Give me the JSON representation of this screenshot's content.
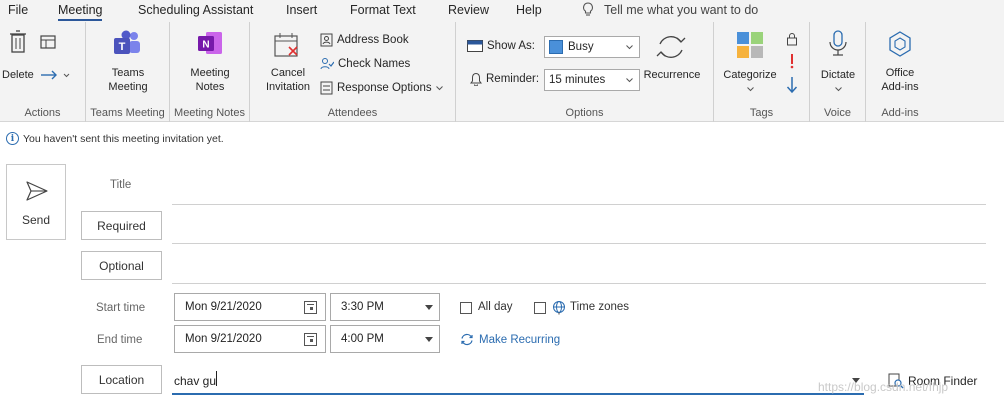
{
  "menu": {
    "tabs": [
      "File",
      "Meeting",
      "Scheduling Assistant",
      "Insert",
      "Format Text",
      "Review",
      "Help"
    ],
    "active": "Meeting",
    "tell_me": "Tell me what you want to do"
  },
  "ribbon": {
    "actions": {
      "delete_label": "Delete",
      "group_label": "Actions"
    },
    "teams": {
      "button_line1": "Teams",
      "button_line2": "Meeting",
      "group_label": "Teams Meeting"
    },
    "notes": {
      "button_line1": "Meeting",
      "button_line2": "Notes",
      "group_label": "Meeting Notes"
    },
    "attendees": {
      "cancel_line1": "Cancel",
      "cancel_line2": "Invitation",
      "address_book": "Address Book",
      "check_names": "Check Names",
      "response_options": "Response Options",
      "group_label": "Attendees"
    },
    "options": {
      "show_as_label": "Show As:",
      "show_as_value": "Busy",
      "reminder_label": "Reminder:",
      "reminder_value": "15 minutes",
      "recurrence": "Recurrence",
      "group_label": "Options"
    },
    "tags": {
      "categorize": "Categorize",
      "group_label": "Tags"
    },
    "voice": {
      "dictate": "Dictate",
      "group_label": "Voice"
    },
    "addins": {
      "line1": "Office",
      "line2": "Add-ins",
      "group_label": "Add-ins"
    }
  },
  "info_bar": {
    "message": "You haven't sent this meeting invitation yet."
  },
  "form": {
    "send_label": "Send",
    "title_label": "Title",
    "required_label": "Required",
    "optional_label": "Optional",
    "start_label": "Start time",
    "end_label": "End time",
    "start_date": "Mon 9/21/2020",
    "start_time": "3:30 PM",
    "end_date": "Mon 9/21/2020",
    "end_time": "4:00 PM",
    "all_day_label": "All day",
    "time_zones_label": "Time zones",
    "make_recurring": "Make Recurring",
    "location_label": "Location",
    "location_value": "chav gu",
    "room_finder": "Room Finder"
  },
  "watermark": "https://blog.csdn.net/fhjp",
  "colors": {
    "accent": "#2b579a",
    "link": "#2b6cb0",
    "teams": "#5059c9",
    "onenote": "#7719aa",
    "reminder_red": "#e03030"
  }
}
